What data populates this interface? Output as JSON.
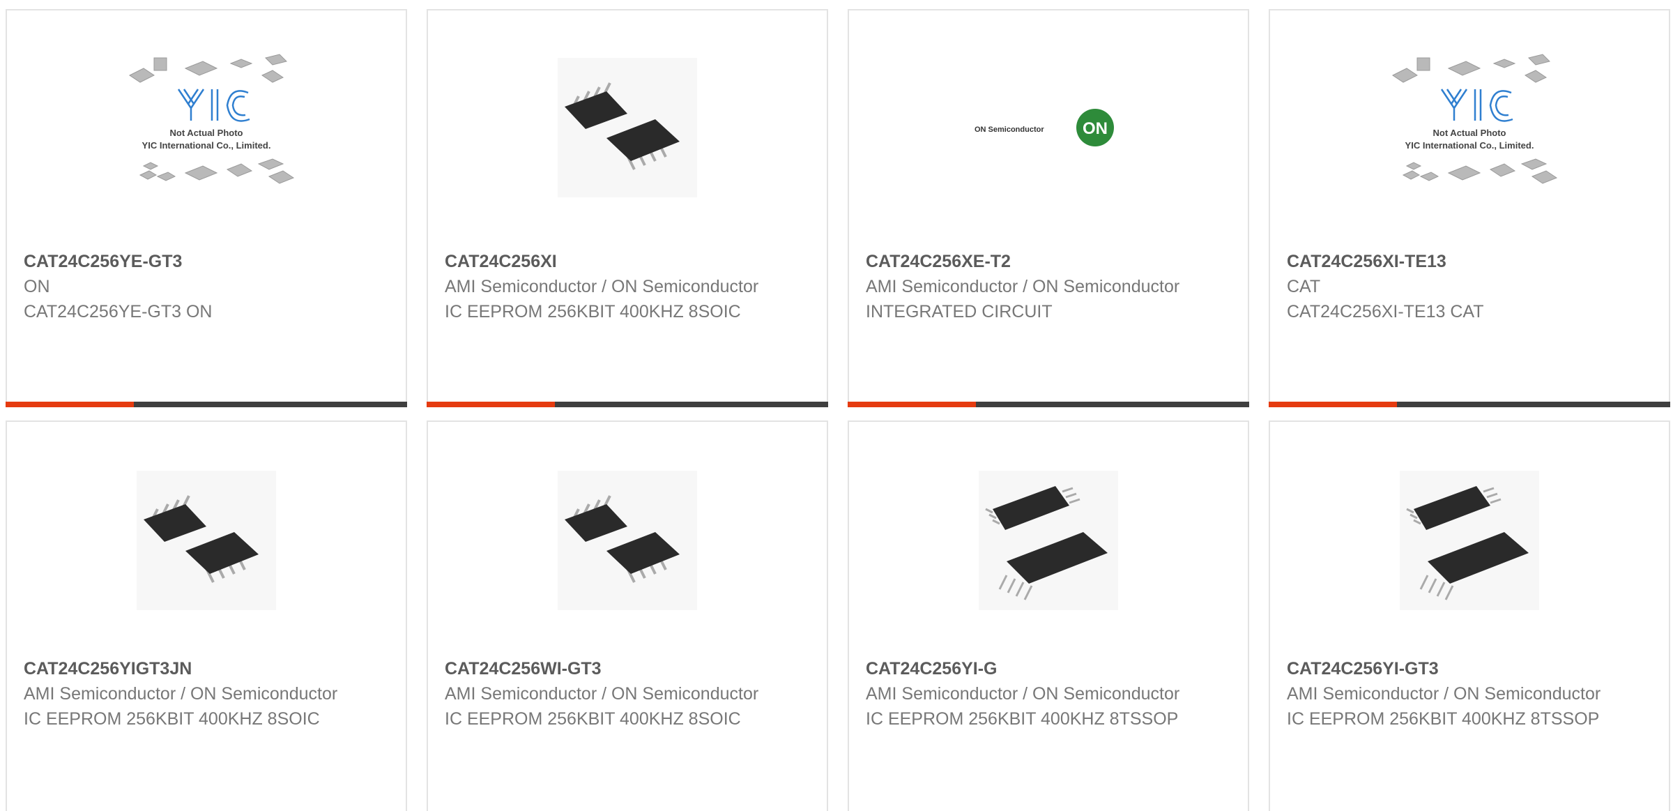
{
  "products": [
    {
      "part": "CAT24C256YE-GT3",
      "manufacturer": "ON",
      "description": "CAT24C256YE-GT3 ON",
      "image": "placeholder"
    },
    {
      "part": "CAT24C256XI",
      "manufacturer": "AMI Semiconductor / ON Semiconductor",
      "description": "IC EEPROM 256KBIT 400KHZ 8SOIC",
      "image": "soic"
    },
    {
      "part": "CAT24C256XE-T2",
      "manufacturer": "AMI Semiconductor / ON Semiconductor",
      "description": "INTEGRATED CIRCUIT",
      "image": "onsemi-logo"
    },
    {
      "part": "CAT24C256XI-TE13",
      "manufacturer": "CAT",
      "description": "CAT24C256XI-TE13 CAT",
      "image": "placeholder"
    },
    {
      "part": "CAT24C256YIGT3JN",
      "manufacturer": "AMI Semiconductor / ON Semiconductor",
      "description": "IC EEPROM 256KBIT 400KHZ 8SOIC",
      "image": "soic"
    },
    {
      "part": "CAT24C256WI-GT3",
      "manufacturer": "AMI Semiconductor / ON Semiconductor",
      "description": "IC EEPROM 256KBIT 400KHZ 8SOIC",
      "image": "soic"
    },
    {
      "part": "CAT24C256YI-G",
      "manufacturer": "AMI Semiconductor / ON Semiconductor",
      "description": "IC EEPROM 256KBIT 400KHZ 8TSSOP",
      "image": "tssop"
    },
    {
      "part": "CAT24C256YI-GT3",
      "manufacturer": "AMI Semiconductor / ON Semiconductor",
      "description": "IC EEPROM 256KBIT 400KHZ 8TSSOP",
      "image": "tssop"
    }
  ],
  "placeholder": {
    "line1": "Not Actual Photo",
    "line2": "YIC International Co., Limited.",
    "logo_text": "YIC"
  },
  "onsemi": {
    "wordmark": "ON Semiconductor",
    "badge": "ON"
  },
  "colors": {
    "accent": "#e53b10",
    "bar": "#3f3f3f",
    "onsemi_green": "#2e8b3a"
  }
}
